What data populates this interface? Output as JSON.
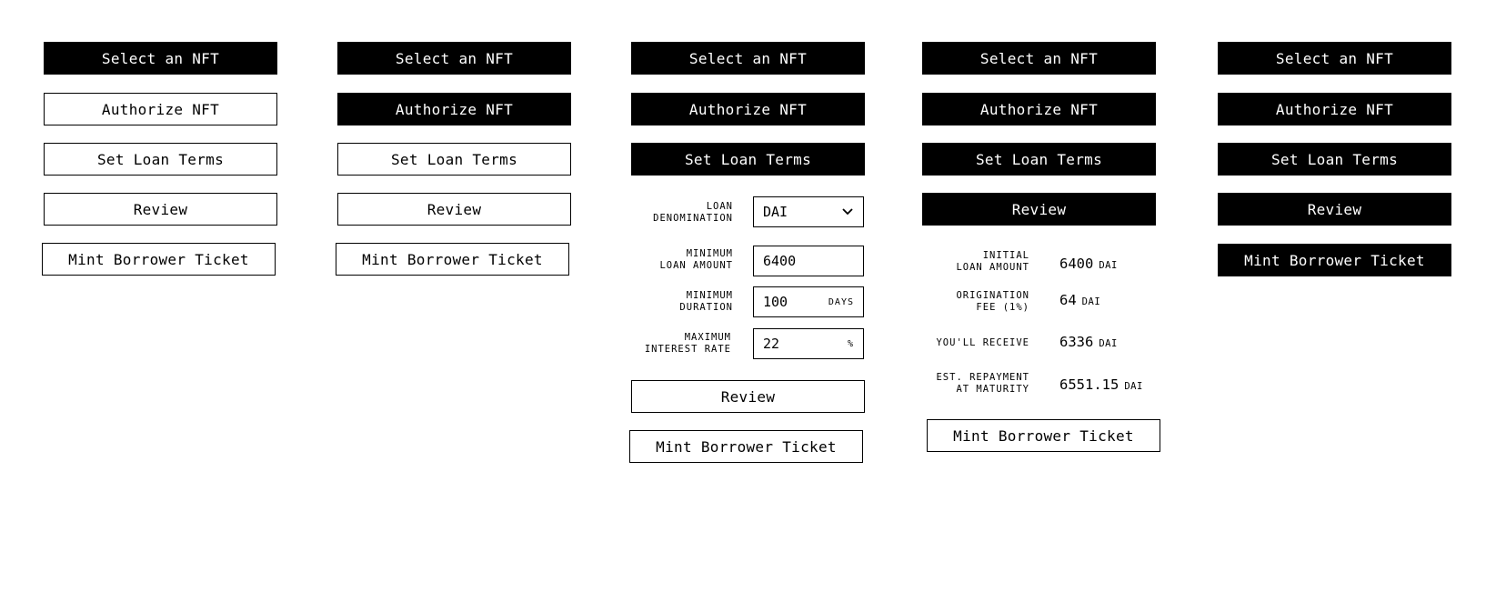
{
  "steps": {
    "select": "Select an NFT",
    "authorize": "Authorize NFT",
    "terms": "Set Loan Terms",
    "review": "Review",
    "mint": "Mint Borrower Ticket"
  },
  "form": {
    "denomination_label": "LOAN\nDENOMINATION",
    "denomination_value": "DAI",
    "min_amount_label": "MINIMUM\nLOAN AMOUNT",
    "min_amount_value": "6400",
    "min_duration_label": "MINIMUM\nDURATION",
    "min_duration_value": "100",
    "min_duration_unit": "DAYS",
    "max_rate_label": "MAXIMUM\nINTEREST RATE",
    "max_rate_value": "22",
    "max_rate_unit": "%"
  },
  "summary": {
    "initial_label": "INITIAL\nLOAN AMOUNT",
    "initial_value": "6400",
    "fee_label": "ORIGINATION\nFEE (1%)",
    "fee_value": "64",
    "receive_label": "YOU'LL RECEIVE",
    "receive_value": "6336",
    "repay_label": "EST. REPAYMENT\nAT MATURITY",
    "repay_value": "6551.15",
    "unit": "DAI"
  },
  "colors": {
    "active_fill": "#000000",
    "inactive_fill": "#ffffff"
  },
  "icons": {
    "dropdown": "chevron-down-icon"
  }
}
